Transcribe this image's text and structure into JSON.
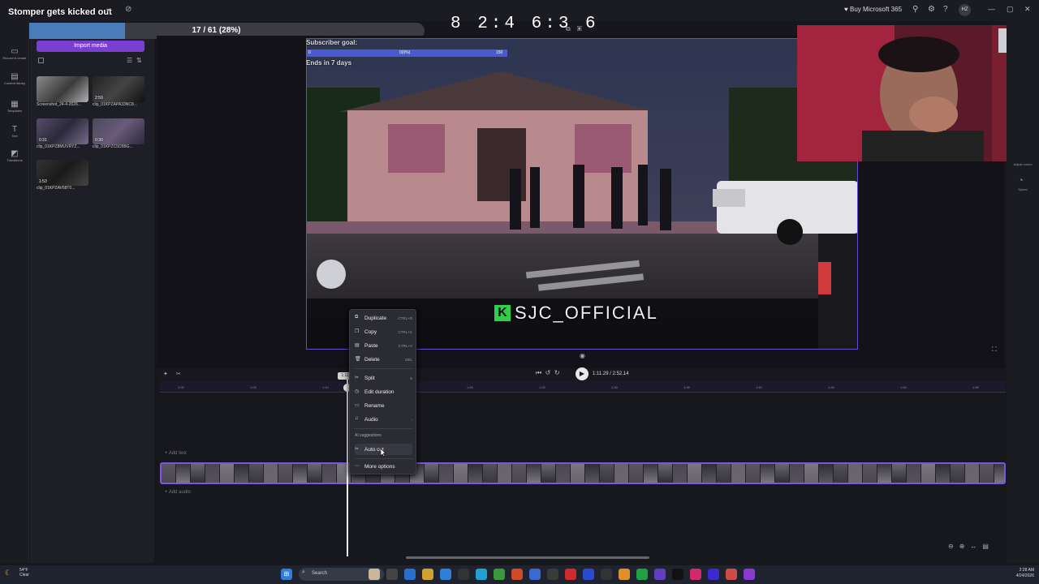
{
  "overlay": {
    "stream_title": "Stomper gets kicked out",
    "timer": "8 2:4 6:3 6",
    "progress_text": "17 / 61 (28%)",
    "progress_fraction": 0.28
  },
  "titlebar": {
    "buy_label": "Buy Microsoft 365",
    "avatar_initials": "HZ"
  },
  "left_rail": {
    "items": [
      {
        "icon": "video-icon",
        "label": "Record & create"
      },
      {
        "icon": "library-icon",
        "label": "Content library"
      },
      {
        "icon": "templates-icon",
        "label": "Templates"
      },
      {
        "icon": "text-icon",
        "label": "Text"
      },
      {
        "icon": "transitions-icon",
        "label": "Transitions"
      }
    ]
  },
  "media": {
    "import_label": "Import media",
    "items": [
      {
        "name": "Screenshot_24-4-2026...",
        "duration": ""
      },
      {
        "name": "clip_01KPZAPA33NC8...",
        "duration": "2:59"
      },
      {
        "name": "clip_01KPZ8MUVRYZ...",
        "duration": "0:31"
      },
      {
        "name": "clip_01KPZC5D5BG...",
        "duration": "0:30"
      },
      {
        "name": "clip_01KPZAV68T0...",
        "duration": "1:53"
      }
    ]
  },
  "preview": {
    "subscriber_goal_label": "Subscriber goal:",
    "goal_start": "0",
    "goal_progress": "0(0%)",
    "goal_target": "150",
    "ends_label": "Ends in 7 days",
    "watermark": "SJC_OFFICIAL",
    "watermark_k": "K"
  },
  "right_rail": {
    "items": [
      "Adjust colors",
      "Speed"
    ]
  },
  "playback": {
    "time": "1:11.29 / 2:52.14",
    "playhead_label": "1:11"
  },
  "timeline": {
    "ticks": [
      "1:00",
      "1:05",
      "1:10",
      "1:15",
      "1:20",
      "1:25",
      "1:30",
      "1:35",
      "1:40",
      "1:45",
      "1:50",
      "1:55"
    ],
    "add_text": "+ Add text",
    "add_audio": "+ Add audio"
  },
  "context_menu": {
    "items": [
      {
        "label": "Duplicate",
        "shortcut": "CTRL+D",
        "icon": "duplicate-icon"
      },
      {
        "label": "Copy",
        "shortcut": "CTRL+C",
        "icon": "copy-icon"
      },
      {
        "label": "Paste",
        "shortcut": "CTRL+V",
        "icon": "paste-icon"
      },
      {
        "label": "Delete",
        "shortcut": "DEL",
        "icon": "trash-icon"
      },
      {
        "label": "Split",
        "shortcut": "S",
        "icon": "scissors-icon"
      },
      {
        "label": "Edit duration",
        "shortcut": "",
        "icon": "clock-icon"
      },
      {
        "label": "Rename",
        "shortcut": "",
        "icon": "rename-icon"
      },
      {
        "label": "Audio",
        "shortcut": "",
        "icon": "music-icon"
      }
    ],
    "ai_heading": "AI suggestions",
    "auto_cut": "Auto cut",
    "more_options": "More options"
  },
  "taskbar": {
    "weather_temp": "54°F",
    "weather_desc": "Clear",
    "search_label": "Search",
    "time": "2:28 AM",
    "date": "4/24/2026"
  }
}
